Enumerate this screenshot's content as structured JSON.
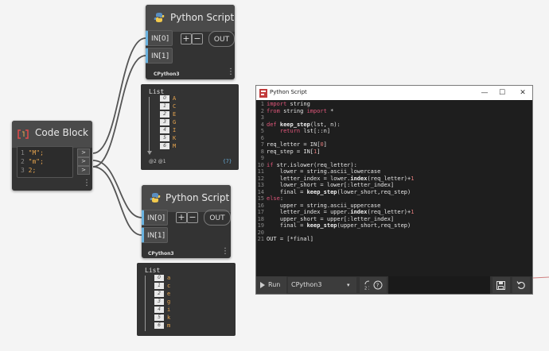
{
  "colors": {
    "accent_port": "#6ab3e0",
    "string_value": "#e6a44f",
    "keyword": "#e0567a"
  },
  "python_node_1": {
    "title": "Python Script",
    "in0": "IN[0]",
    "in1": "IN[1]",
    "add": "+",
    "remove": "−",
    "out": "OUT",
    "engine": "CPython3",
    "menu": "⋮",
    "icon": "python-logo-icon"
  },
  "watch_1": {
    "title": "List",
    "rows": [
      {
        "idx": "0",
        "val": "A"
      },
      {
        "idx": "1",
        "val": "C"
      },
      {
        "idx": "2",
        "val": "E"
      },
      {
        "idx": "3",
        "val": "G"
      },
      {
        "idx": "4",
        "val": "I"
      },
      {
        "idx": "5",
        "val": "K"
      },
      {
        "idx": "6",
        "val": "M"
      }
    ],
    "levels": "@2 @1",
    "count": "{7}"
  },
  "code_block": {
    "title": "Code Block",
    "icon": "code-block-icon",
    "lines": [
      {
        "n": "1",
        "text": "\"M\";"
      },
      {
        "n": "2",
        "text": "\"m\";"
      },
      {
        "n": "3",
        "text": "2;"
      }
    ],
    "out_arrow": ">",
    "menu": "⋮"
  },
  "python_node_2": {
    "title": "Python Script",
    "in0": "IN[0]",
    "in1": "IN[1]",
    "add": "+",
    "remove": "−",
    "out": "OUT",
    "engine": "CPython3",
    "menu": "⋮",
    "icon": "python-logo-icon"
  },
  "watch_2": {
    "title": "List",
    "rows": [
      {
        "idx": "0",
        "val": "a"
      },
      {
        "idx": "1",
        "val": "c"
      },
      {
        "idx": "2",
        "val": "e"
      },
      {
        "idx": "3",
        "val": "g"
      },
      {
        "idx": "4",
        "val": "i"
      },
      {
        "idx": "5",
        "val": "k"
      },
      {
        "idx": "6",
        "val": "m"
      }
    ]
  },
  "editor": {
    "title": "Python Script",
    "minimize": "—",
    "maximize": "☐",
    "close": "✕",
    "line_numbers": [
      "1",
      "2",
      "3",
      "4",
      "5",
      "6",
      "7",
      "8",
      "9",
      "10",
      "11",
      "12",
      "13",
      "14",
      "15",
      "16",
      "17",
      "18",
      "19",
      "20",
      "21"
    ],
    "run_label": "Run",
    "run_icon": "play-icon",
    "engine": "CPython3",
    "engine_arrow": "▾",
    "buttons": {
      "convert_icon": "convert-tabs-icon",
      "help_icon": "help-icon",
      "save_icon": "save-icon",
      "revert_icon": "revert-icon"
    }
  }
}
